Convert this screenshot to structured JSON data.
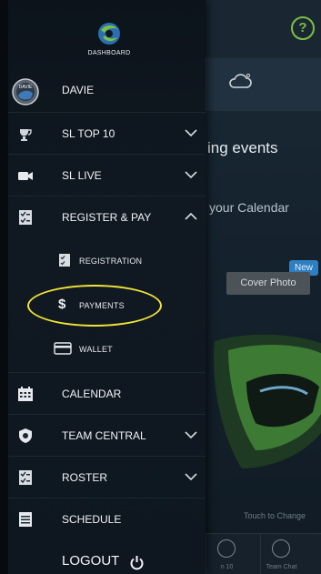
{
  "background": {
    "events_fragment": "ing events",
    "calendar_fragment": "your Calendar",
    "new_badge": "New",
    "cover_photo": "Cover Photo",
    "touch_to_change": "Touch to Change",
    "bottom_tabs": [
      "n 10",
      "Team Chat"
    ],
    "icons": {
      "help": "help-circle-icon",
      "weather": "cloud-icon"
    },
    "help_glyph": "?"
  },
  "drawer": {
    "dashboard_label": "DASHBOARD",
    "profile": {
      "name": "DAVIE",
      "avatar_text": "DAVIE"
    },
    "items": [
      {
        "label": "SL TOP 10",
        "icon": "trophy-icon",
        "expand": "collapsed"
      },
      {
        "label": "SL LIVE",
        "icon": "video-camera-icon",
        "expand": "collapsed"
      },
      {
        "label": "REGISTER & PAY",
        "icon": "checklist-icon",
        "expand": "expanded"
      }
    ],
    "submenu": [
      {
        "label": "REGISTRATION",
        "icon": "checklist-icon"
      },
      {
        "label": "PAYMENTS",
        "icon": "dollar-icon",
        "glyph": "$",
        "highlighted": true
      },
      {
        "label": "WALLET",
        "icon": "card-icon"
      }
    ],
    "items_lower": [
      {
        "label": "CALENDAR",
        "icon": "calendar-icon"
      },
      {
        "label": "TEAM CENTRAL",
        "icon": "shield-icon",
        "expand": "collapsed"
      },
      {
        "label": "ROSTER",
        "icon": "checklist-icon",
        "expand": "collapsed"
      },
      {
        "label": "SCHEDULE",
        "icon": "list-icon"
      }
    ],
    "logout": "LOGOUT"
  },
  "colors": {
    "highlight_ring": "#f1e437",
    "brand_green": "#7bc043",
    "brand_blue": "#2f7fc0"
  }
}
